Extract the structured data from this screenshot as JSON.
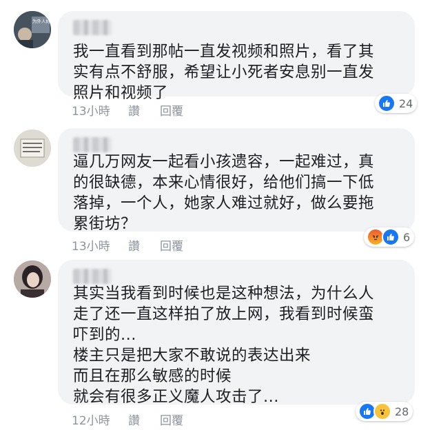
{
  "comments": [
    {
      "avatar_caption": "为外人好 對家人要更好",
      "text": "我一直看到那帖一直发视频和照片，看了其\n实有点不舒服，希望让小死者安息别一直发\n照片和视频了",
      "time": "13小時",
      "like_label": "讚",
      "reply_label": "回覆",
      "reactions": [
        "like-icon"
      ],
      "reaction_count": "24"
    },
    {
      "avatar_caption": "",
      "text": "逼几万网友一起看小孩遗容，一起难过，真\n的很缺德，本来心情很好，给他们搞一下低\n落掉，一个人，她家人难过就好，做么要拖\n累街坊？",
      "time": "13小時",
      "like_label": "讚",
      "reply_label": "回覆",
      "reactions": [
        "angry-icon",
        "like-icon"
      ],
      "reaction_count": "6"
    },
    {
      "avatar_caption": "",
      "text": "其实当我看到时候也是这种想法，为什么人\n走了还一直这样拍了放上网，我看到时候蛮\n吓到的...\n楼主只是把大家不敢说的表达出来\n而且在那么敏感的时候\n就会有很多正义魔人攻击了...",
      "time": "12小時",
      "like_label": "讚",
      "reply_label": "回覆",
      "reactions": [
        "like-icon",
        "wow-icon"
      ],
      "reaction_count": "28"
    }
  ],
  "colors": {
    "bubble": "#f2f3f5",
    "like_blue": "#1877f2",
    "meta_gray": "#8d949e"
  }
}
